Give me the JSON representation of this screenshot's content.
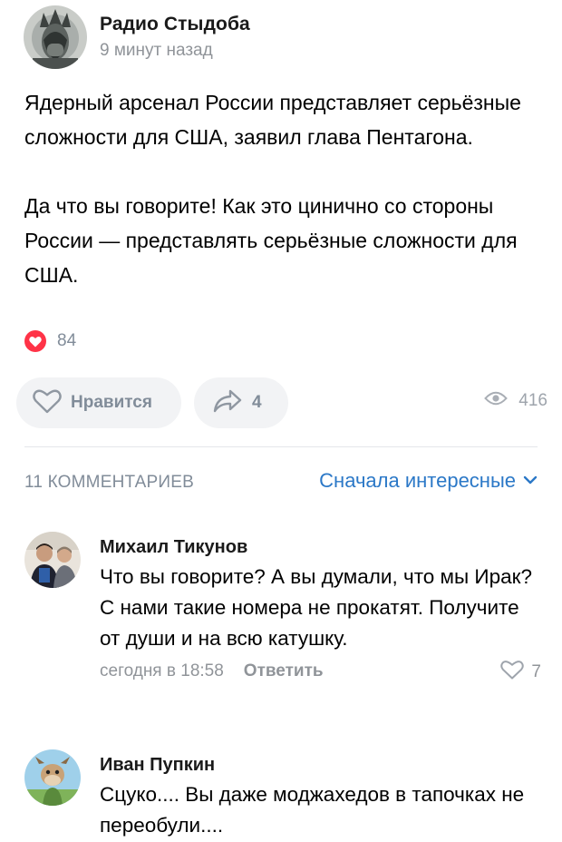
{
  "post": {
    "author": "Радио Стыдоба",
    "time": "9 минут назад",
    "paragraphs": [
      "Ядерный арсенал России представляет серьёзные сложности для США, заявил глава Пентагона.",
      "Да что вы говорите! Как это цинично со стороны России — представлять серьёзные сложности для США."
    ],
    "reactions_count": "84",
    "like_label": "Нравится",
    "share_count": "4",
    "views_count": "416"
  },
  "comments_bar": {
    "count_label": "11 КОММЕНТАРИЕВ",
    "sort_label": "Сначала интересные"
  },
  "comments": [
    {
      "author": "Михаил Тикунов",
      "text": "Что вы говорите? А вы думали, что мы Ирак? С нами такие номера не прокатят. Получите от души и на всю катушку.",
      "date": "сегодня в 18:58",
      "reply_label": "Ответить",
      "likes": "7"
    },
    {
      "author": "Иван Пупкин",
      "text": "Сцуко.... Вы даже моджахедов в тапочках не переобули...."
    }
  ],
  "icons": {
    "heart": "heart-icon",
    "share": "share-icon",
    "eye": "eye-icon",
    "chevron": "chevron-down-icon"
  },
  "colors": {
    "accent": "#2b78c7",
    "reaction": "#ff3347",
    "muted": "#818c99",
    "pill_bg": "#f2f3f5"
  }
}
